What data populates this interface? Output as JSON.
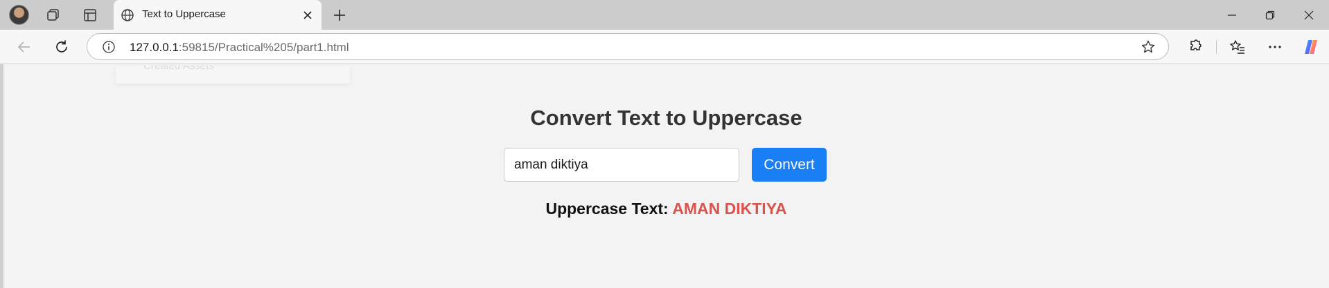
{
  "browser": {
    "tab": {
      "title": "Text to Uppercase"
    },
    "address": {
      "host": "127.0.0.1",
      "rest": ":59815/Practical%205/part1.html"
    },
    "icons": [
      "profile-avatar",
      "workspaces-icon",
      "tab-actions-icon",
      "globe-icon",
      "close-icon",
      "plus-icon",
      "minimize-icon",
      "restore-icon",
      "window-close-icon",
      "back-icon",
      "refresh-icon",
      "info-icon",
      "star-icon",
      "extensions-icon",
      "favorites-icon",
      "more-icon",
      "copilot-icon"
    ]
  },
  "page": {
    "ghost_text": "Created Assets",
    "heading": "Convert Text to Uppercase",
    "input_value": "aman diktiya",
    "button_label": "Convert",
    "result_label": "Uppercase Text:",
    "result_value": "AMAN DIKTIYA"
  },
  "colors": {
    "accent": "#1a7ef5",
    "result": "#d9534f",
    "heading": "#333333",
    "page_bg": "#f3f3f3"
  }
}
